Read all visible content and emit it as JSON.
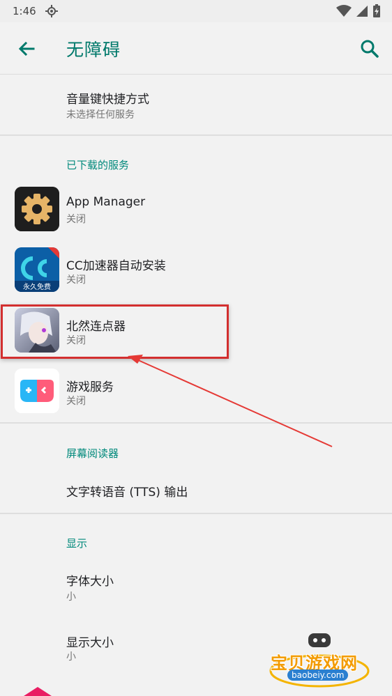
{
  "status": {
    "time": "1:46"
  },
  "appbar": {
    "title": "无障碍"
  },
  "shortcut": {
    "title": "音量键快捷方式",
    "subtitle": "未选择任何服务"
  },
  "downloaded": {
    "header": "已下载的服务",
    "items": [
      {
        "title": "App Manager",
        "subtitle": "关闭",
        "icon": "gear-icon"
      },
      {
        "title": "CC加速器自动安装",
        "subtitle": "关闭",
        "icon": "cc-accelerator-icon",
        "badge": "永久免费"
      },
      {
        "title": "北然连点器",
        "subtitle": "关闭",
        "icon": "anime-character-icon"
      },
      {
        "title": "游戏服务",
        "subtitle": "关闭",
        "icon": "game-controller-icon"
      }
    ]
  },
  "screen_reader": {
    "header": "屏幕阅读器",
    "items": [
      {
        "title": "文字转语音 (TTS) 输出"
      }
    ]
  },
  "display": {
    "header": "显示",
    "items": [
      {
        "title": "字体大小",
        "subtitle": "小"
      },
      {
        "title": "显示大小",
        "subtitle": "小"
      }
    ]
  },
  "watermark": {
    "text": "宝贝游戏网",
    "url": "baobeiy.com"
  },
  "colors": {
    "accent": "#00796b",
    "highlight": "#d32f2f"
  }
}
